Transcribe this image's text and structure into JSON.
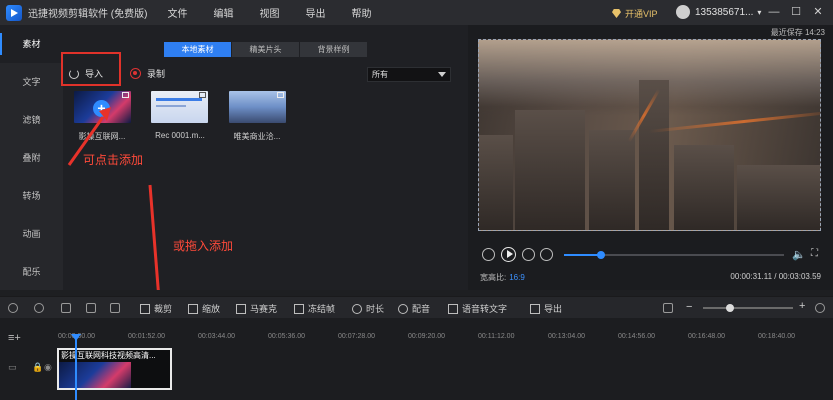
{
  "app": {
    "title": "迅捷视频剪辑软件 (免费版)"
  },
  "menu": [
    "文件",
    "编辑",
    "视图",
    "导出",
    "帮助"
  ],
  "vip": {
    "label": "开通VIP"
  },
  "account": {
    "name": "135385671..."
  },
  "window_buttons": {
    "minimize": "—",
    "restore": "☐",
    "close": "✕"
  },
  "sidebar": {
    "items": [
      "素材",
      "文字",
      "滤镜",
      "叠附",
      "转场",
      "动画",
      "配乐"
    ],
    "active": 0
  },
  "media": {
    "tabs": [
      "本地素材",
      "精美片头",
      "背景样例"
    ],
    "active_tab": 0,
    "import_label": "导入",
    "record_label": "录制",
    "filter_value": "所有",
    "items": [
      {
        "label": "影操互联网..."
      },
      {
        "label": "Rec 0001.m..."
      },
      {
        "label": "唯美商业洽..."
      }
    ],
    "add_symbol": "+"
  },
  "annotations": {
    "click_add": "可点击添加",
    "drag_add": "或拖入添加"
  },
  "preview": {
    "save_status": "最近保存 14:23",
    "aspect_label": "宽高比:",
    "aspect_value": "16:9",
    "time_current": "00:00:31.11",
    "time_total": "00:03:03.59",
    "progress": 0.17
  },
  "toolbar": {
    "items": [
      "裁剪",
      "缩放",
      "马赛克",
      "冻结帧",
      "时长",
      "配音",
      "语音转文字",
      "导出"
    ]
  },
  "timeline": {
    "ticks": [
      "00:00:00.00",
      "00:01:52.00",
      "00:03:44.00",
      "00:05:36.00",
      "00:07:28.00",
      "00:09:20.00",
      "00:11:12.00",
      "00:13:04.00",
      "00:14:56.00",
      "00:16:48.00",
      "00:18:40.00"
    ],
    "clip_name": "影操互联网科技视频高清...",
    "zoom_level": 0.3
  },
  "colors": {
    "accent": "#2f8cff",
    "annotation": "#ff4a3a",
    "vip": "#e8c26a"
  }
}
